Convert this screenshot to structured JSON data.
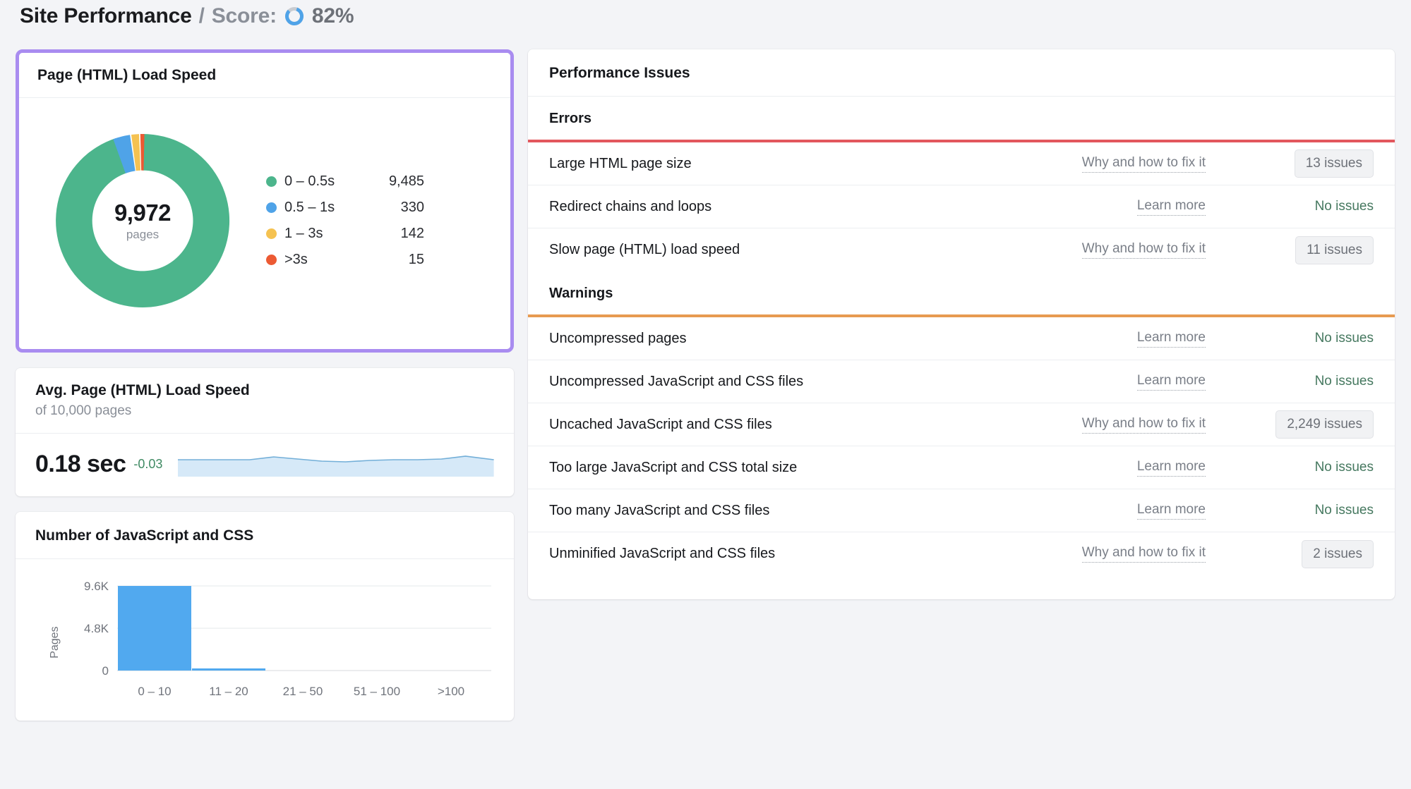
{
  "header": {
    "title": "Site Performance",
    "separator": "/",
    "score_label": "Score:",
    "score_value": "82%",
    "score_percent": 82,
    "ring_color": "#4fa3e8",
    "ring_track": "#c9ccd1"
  },
  "load_speed_card": {
    "title": "Page (HTML) Load Speed",
    "highlighted": true,
    "highlight_color": "#a98cf0",
    "total": "9,972",
    "total_unit": "pages"
  },
  "avg_card": {
    "title": "Avg. Page (HTML) Load Speed",
    "subtitle": "of 10,000 pages",
    "value": "0.18 sec",
    "delta": "-0.03",
    "delta_color": "#3f8a63",
    "spark_fill": "#d6e9f8",
    "spark_line": "#73afd8"
  },
  "js_css_card": {
    "title": "Number of JavaScript and CSS"
  },
  "issues_panel": {
    "title": "Performance Issues",
    "sections": [
      {
        "name": "Errors",
        "rule_color": "#e2575d",
        "rows": [
          {
            "name": "Large HTML page size",
            "link": "Why and how to fix it",
            "status": "13 issues",
            "status_type": "badge"
          },
          {
            "name": "Redirect chains and loops",
            "link": "Learn more",
            "status": "No issues",
            "status_type": "none"
          },
          {
            "name": "Slow page (HTML) load speed",
            "link": "Why and how to fix it",
            "status": "11 issues",
            "status_type": "badge"
          }
        ]
      },
      {
        "name": "Warnings",
        "rule_color": "#e79a51",
        "rows": [
          {
            "name": "Uncompressed pages",
            "link": "Learn more",
            "status": "No issues",
            "status_type": "none"
          },
          {
            "name": "Uncompressed JavaScript and CSS files",
            "link": "Learn more",
            "status": "No issues",
            "status_type": "none"
          },
          {
            "name": "Uncached JavaScript and CSS files",
            "link": "Why and how to fix it",
            "status": "2,249 issues",
            "status_type": "badge"
          },
          {
            "name": "Too large JavaScript and CSS total size",
            "link": "Learn more",
            "status": "No issues",
            "status_type": "none"
          },
          {
            "name": "Too many JavaScript and CSS files",
            "link": "Learn more",
            "status": "No issues",
            "status_type": "none"
          },
          {
            "name": "Unminified JavaScript and CSS files",
            "link": "Why and how to fix it",
            "status": "2 issues",
            "status_type": "badge"
          }
        ]
      }
    ]
  },
  "chart_data": [
    {
      "type": "pie",
      "title": "Page (HTML) Load Speed",
      "center_label": "9,972",
      "center_sublabel": "pages",
      "categories": [
        "0 – 0.5s",
        "0.5 – 1s",
        "1 – 3s",
        ">3s"
      ],
      "values": [
        9485,
        330,
        142,
        15
      ],
      "colors": [
        "#4cb58c",
        "#4fa3e8",
        "#f5c251",
        "#ec5a33"
      ],
      "legend_position": "right",
      "donut": true
    },
    {
      "type": "area",
      "title": "Avg. Page (HTML) Load Speed",
      "subtitle": "of 10,000 pages",
      "headline_value": "0.18 sec",
      "delta": "-0.03",
      "x": [
        0,
        1,
        2,
        3,
        4,
        5,
        6,
        7,
        8,
        9,
        10,
        11,
        12,
        13
      ],
      "values": [
        0.18,
        0.18,
        0.18,
        0.19,
        0.2,
        0.19,
        0.185,
        0.18,
        0.185,
        0.19,
        0.19,
        0.185,
        0.2,
        0.19
      ],
      "xlabel": "",
      "ylabel": "",
      "grid": false,
      "fill_color": "#d6e9f8",
      "line_color": "#73afd8"
    },
    {
      "type": "bar",
      "title": "Number of JavaScript and CSS",
      "categories": [
        "0 – 10",
        "11 – 20",
        "21 – 50",
        "51 – 100",
        ">100"
      ],
      "values": [
        9600,
        210,
        0,
        0,
        0
      ],
      "xlabel": "",
      "ylabel": "Pages",
      "yticks": [
        "0",
        "4.8K",
        "9.6K"
      ],
      "ytick_values": [
        0,
        4800,
        9600
      ],
      "ylim": [
        0,
        9600
      ],
      "bar_color": "#51a9ef",
      "grid": true
    }
  ]
}
